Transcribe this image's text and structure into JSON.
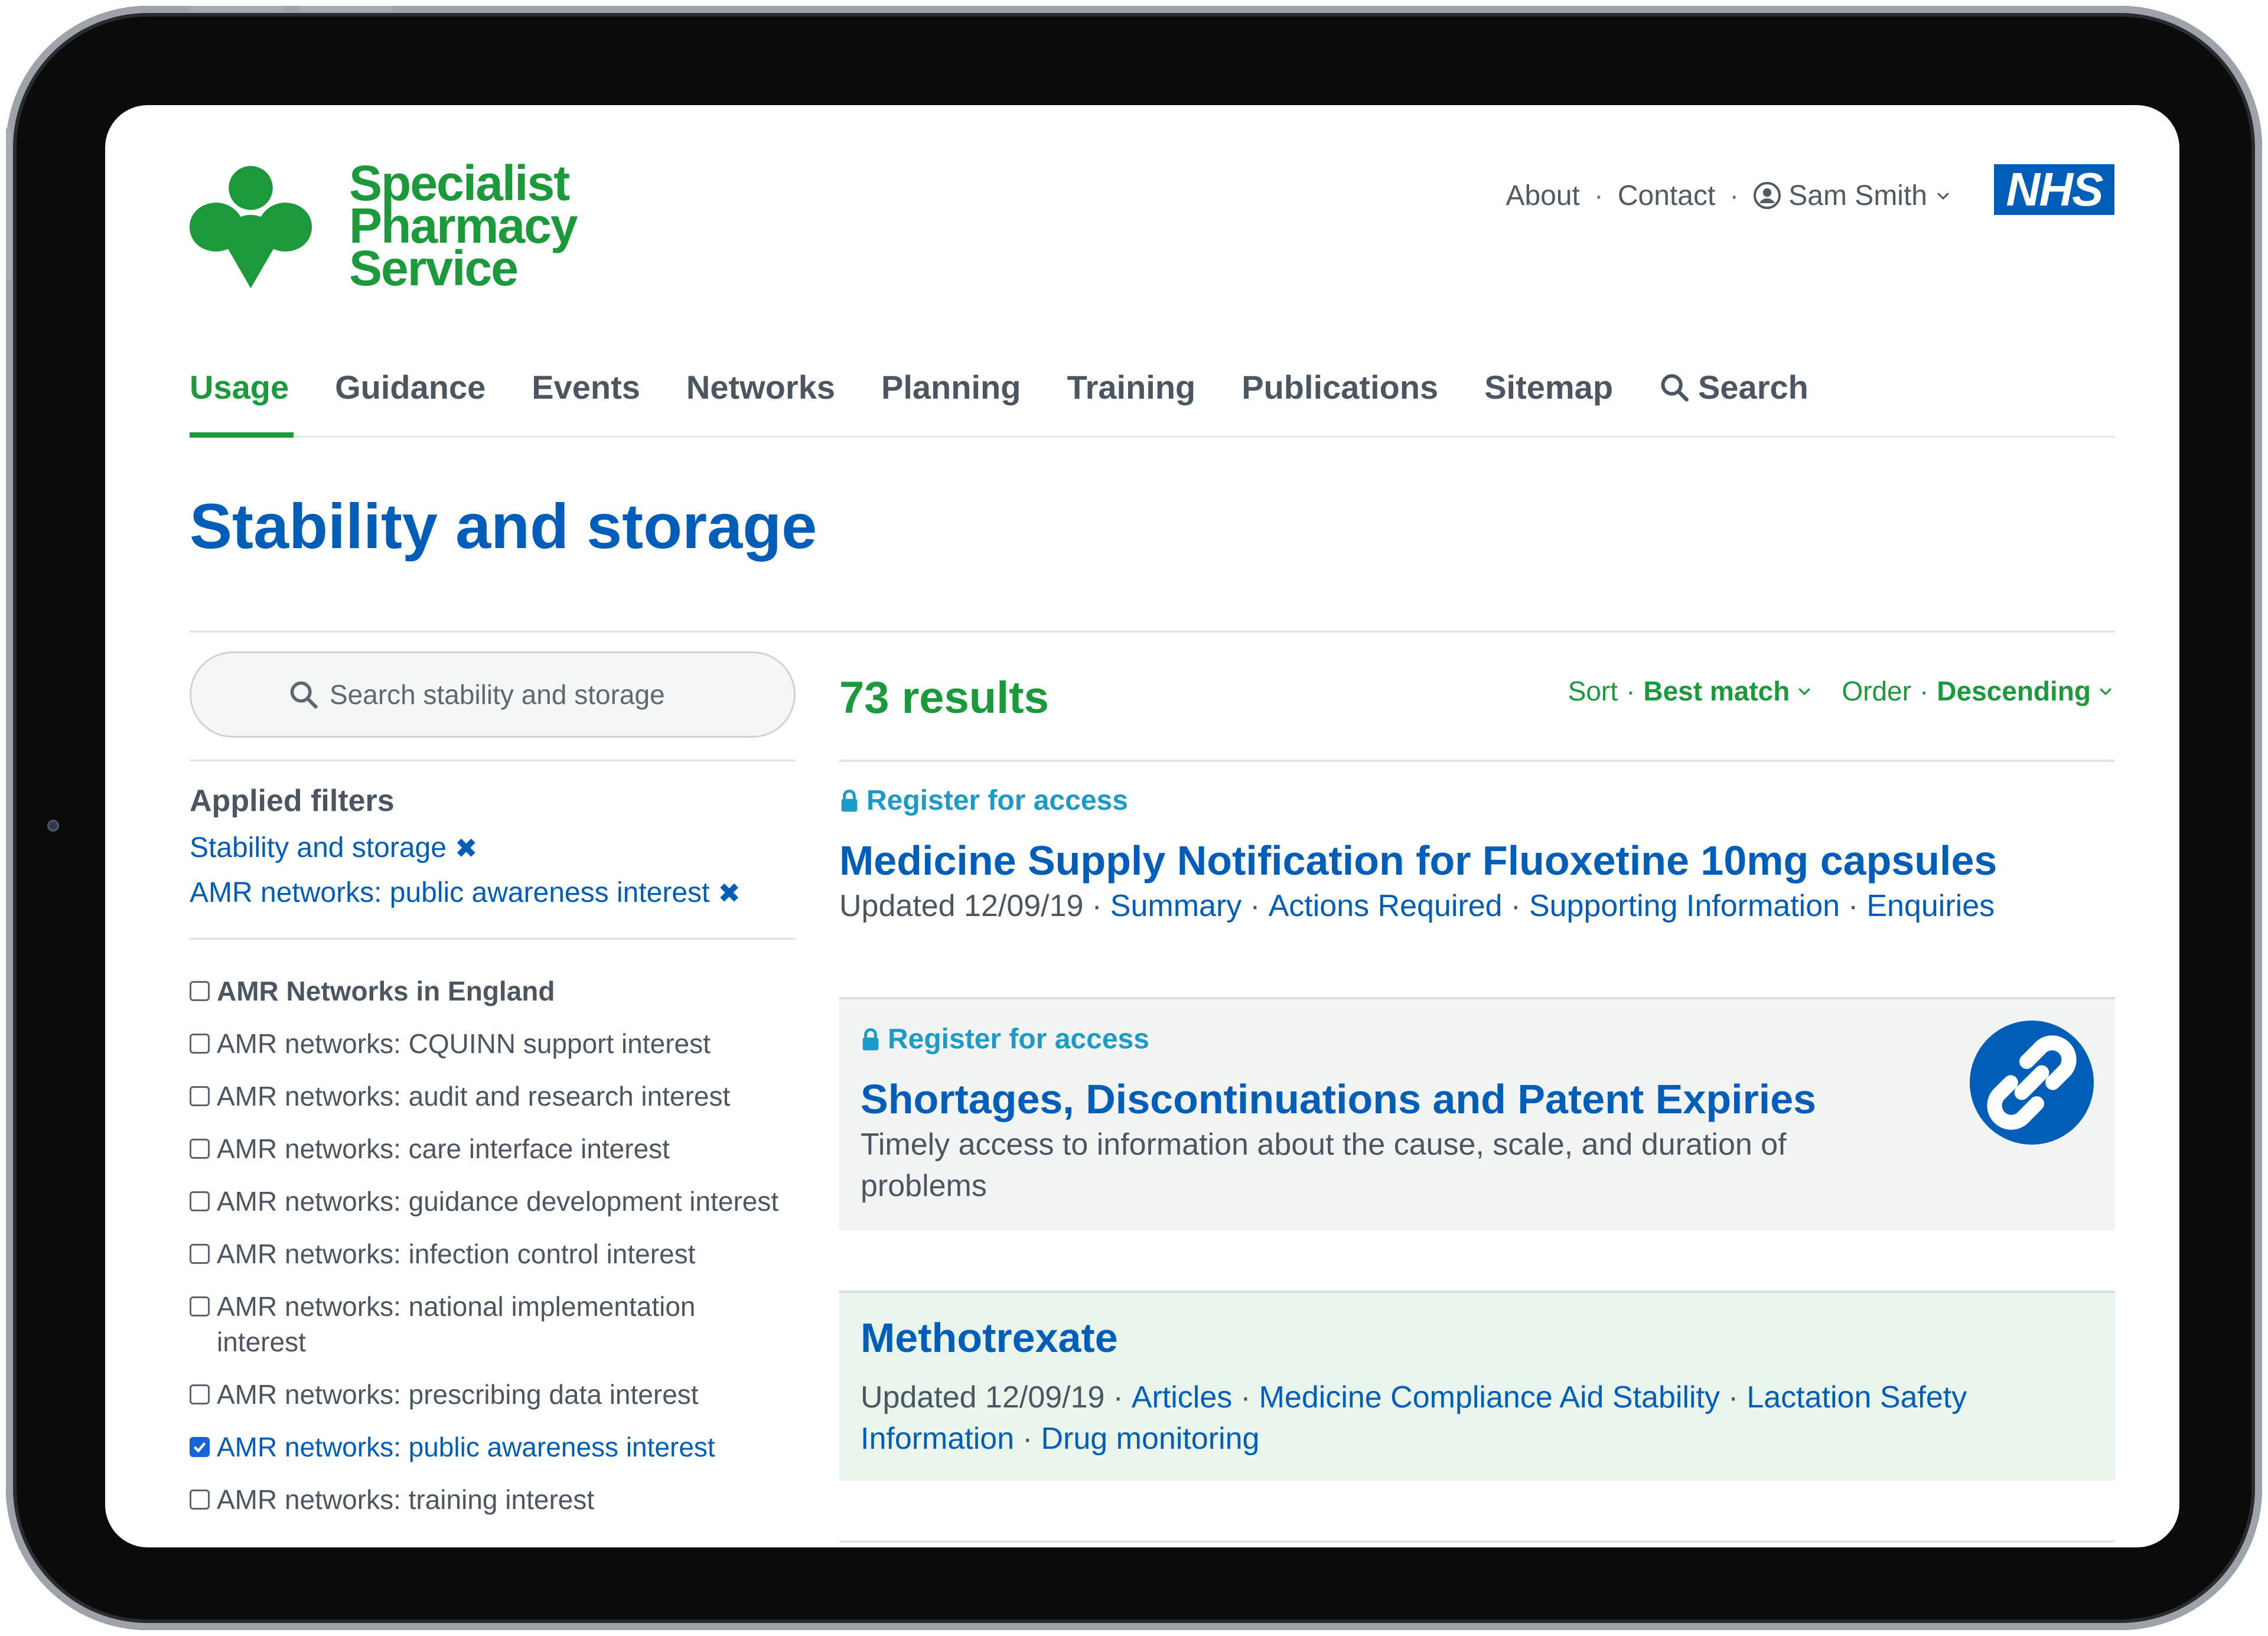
{
  "brand": {
    "line1": "Specialist",
    "line2": "Pharmacy",
    "line3": "Service",
    "primary_color": "#1c9a3b",
    "nhs_logo": "NHS",
    "nhs_color": "#005eb8"
  },
  "topnav": {
    "about": "About",
    "contact": "Contact",
    "user_name": "Sam Smith",
    "user_icon": "user-circle-icon",
    "menu_icon": "chevron-down-icon"
  },
  "mainnav": {
    "items": [
      "Usage",
      "Guidance",
      "Events",
      "Networks",
      "Planning",
      "Training",
      "Publications",
      "Sitemap"
    ],
    "search_label": "Search",
    "active": "Usage"
  },
  "page": {
    "title": "Stability and storage"
  },
  "sidebar": {
    "search_placeholder": "Search stability and storage",
    "applied_filters_title": "Applied filters",
    "applied_filters": [
      "Stability and storage",
      "AMR networks: public awareness interest"
    ],
    "checkboxes": [
      {
        "label": "AMR Networks in England",
        "checked": false
      },
      {
        "label": "AMR networks: CQUINN support interest",
        "checked": false
      },
      {
        "label": "AMR networks: audit and research interest",
        "checked": false
      },
      {
        "label": "AMR networks: care interface interest",
        "checked": false
      },
      {
        "label": "AMR networks: guidance development interest",
        "checked": false
      },
      {
        "label": "AMR networks: infection control interest",
        "checked": false
      },
      {
        "label": "AMR networks: national implementation interest",
        "checked": false
      },
      {
        "label": "AMR networks: prescribing data interest",
        "checked": false
      },
      {
        "label": "AMR networks: public awareness interest",
        "checked": true
      },
      {
        "label": "AMR networks: training interest",
        "checked": false
      }
    ]
  },
  "results": {
    "count": "73 results",
    "sort_label": "Sort",
    "sort_value": "Best match",
    "order_label": "Order",
    "order_value": "Descending",
    "items": [
      {
        "register": "Register for access",
        "title": "Medicine Supply Notification for Fluoxetine 10mg capsules",
        "updated": "Updated 12/09/19",
        "links": [
          "Summary",
          "Actions Required",
          "Supporting Information",
          "Enquiries"
        ]
      },
      {
        "register": "Register for access",
        "title": "Shortages, Discontinuations and Patent Expiries",
        "description": "Timely access to information about the cause, scale, and duration of problems",
        "badge_icon": "broken-link-icon",
        "badge_color": "#005eb8"
      },
      {
        "title": "Methotrexate",
        "updated": "Updated 12/09/19",
        "links": [
          "Articles",
          "Medicine Compliance Aid Stability",
          "Lactation Safety Information",
          "Drug monitoring"
        ]
      }
    ]
  }
}
